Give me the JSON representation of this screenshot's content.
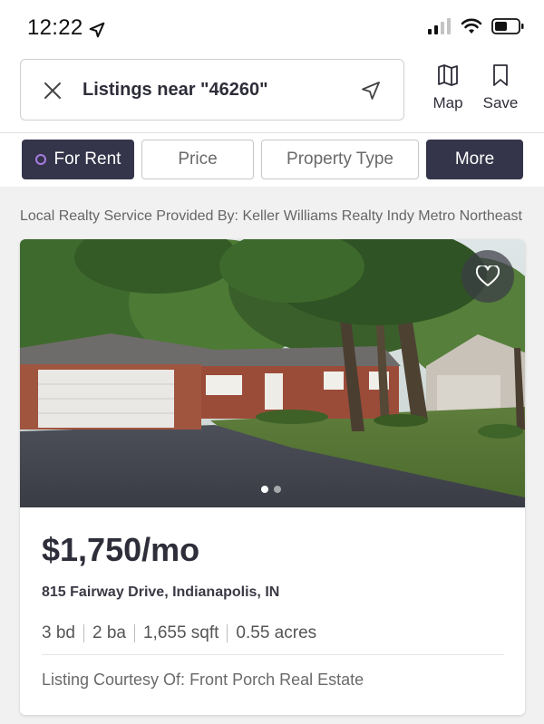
{
  "status_bar": {
    "time": "12:22"
  },
  "search": {
    "query": "Listings near \"46260\""
  },
  "header_actions": {
    "map_label": "Map",
    "save_label": "Save"
  },
  "filters": [
    {
      "label": "For Rent",
      "active": true
    },
    {
      "label": "Price",
      "active": false
    },
    {
      "label": "Property Type",
      "active": false
    },
    {
      "label": "More",
      "active": false
    }
  ],
  "provider_note": "Local Realty Service Provided By: Keller Williams Realty Indy Metro Northeast",
  "listing": {
    "price": "$1,750/mo",
    "address": "815 Fairway Drive, Indianapolis, IN",
    "beds": "3 bd",
    "baths": "2 ba",
    "sqft": "1,655 sqft",
    "lot": "0.55 acres",
    "courtesy": "Listing Courtesy Of: Front Porch Real Estate",
    "photo_count": 2,
    "photo_index": 1
  },
  "colors": {
    "accent_dark": "#34344a",
    "rent_dot": "#a77be0",
    "text_primary": "#2e2e3a"
  },
  "icons": [
    "location-arrow-icon",
    "signal-icon",
    "wifi-icon",
    "battery-icon",
    "close-icon",
    "navigation-icon",
    "map-icon",
    "bookmark-icon",
    "heart-icon"
  ]
}
